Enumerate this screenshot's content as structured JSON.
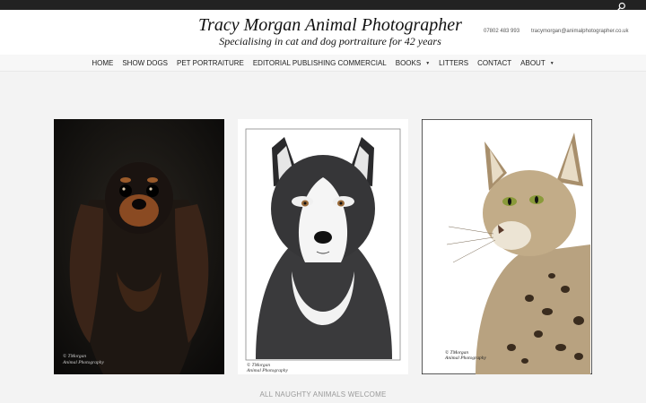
{
  "header": {
    "title": "Tracy Morgan Animal Photographer",
    "tagline": "Specialising in cat and dog portraiture for 42 years",
    "phone": "07802 483 993",
    "email": "tracymorgan@animalphotographer.co.uk"
  },
  "topbar": {
    "search_icon": "search-icon"
  },
  "nav": {
    "items": [
      {
        "label": "HOME"
      },
      {
        "label": "SHOW DOGS"
      },
      {
        "label": "PET PORTRAITURE"
      },
      {
        "label": "EDITORIAL PUBLISHING COMMERCIAL"
      },
      {
        "label": "BOOKS",
        "dropdown": true
      },
      {
        "label": "LITTERS"
      },
      {
        "label": "CONTACT"
      },
      {
        "label": "ABOUT",
        "dropdown": true
      }
    ]
  },
  "gallery": {
    "photos": [
      {
        "subject": "cavalier-king-charles-spaniel",
        "watermark_1": "© TMorgan",
        "watermark_2": "Animal Photography"
      },
      {
        "subject": "alaskan-malamute",
        "watermark_1": "© TMorgan",
        "watermark_2": "Animal Photography"
      },
      {
        "subject": "serval-cat",
        "watermark_1": "© TMorgan",
        "watermark_2": "Animal Photography"
      }
    ]
  },
  "footer_text": "ALL NAUGHTY ANIMALS WELCOME",
  "colors": {
    "topbar": "#222222",
    "header_bg": "#ffffff",
    "page_bg": "#f3f3f3",
    "text_muted": "#9a9a9a"
  }
}
